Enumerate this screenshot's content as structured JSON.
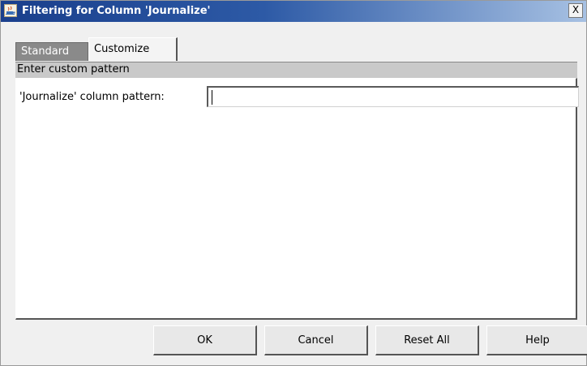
{
  "window": {
    "title": "Filtering for Column 'Journalize'",
    "close_label": "X",
    "icon": "java-cup-icon"
  },
  "tabs": [
    {
      "label": "Standard",
      "selected": false
    },
    {
      "label": "Customize",
      "selected": true
    }
  ],
  "panel": {
    "header": "Enter custom pattern",
    "pattern_label": "'Journalize' column pattern:",
    "pattern_value": ""
  },
  "buttons": {
    "ok": "OK",
    "cancel": "Cancel",
    "reset_all": "Reset All",
    "help": "Help"
  },
  "colors": {
    "titlebar_start": "#1a3f8c",
    "titlebar_end": "#a7c1e3",
    "tab_unselected": "#8a8a8a",
    "panel_header": "#c9c9c9"
  }
}
